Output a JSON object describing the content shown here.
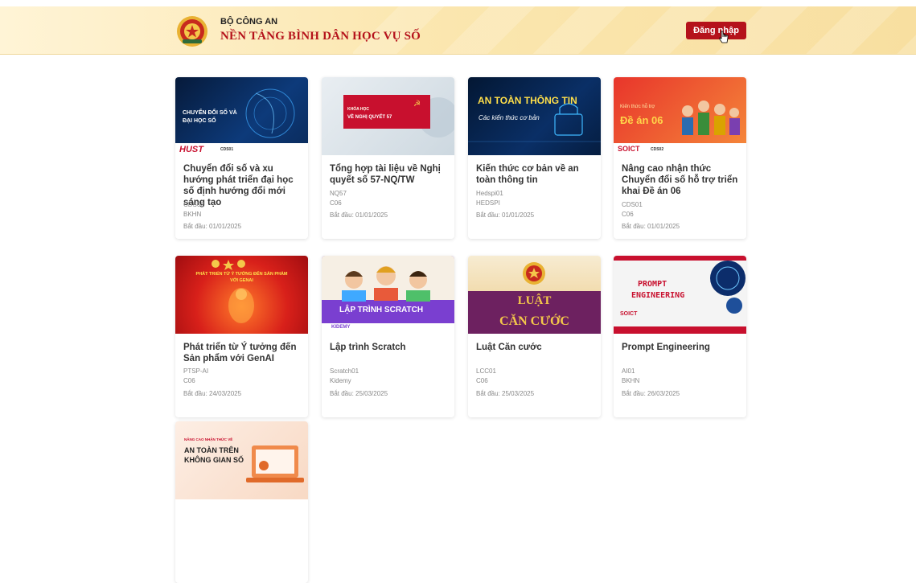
{
  "header": {
    "org_name": "BỘ CÔNG AN",
    "platform_name": "NỀN TẢNG BÌNH DÂN HỌC VỤ SỐ",
    "login_label": "Đăng nhập"
  },
  "courses": [
    {
      "title": "Chuyển đổi số và xu hướng phát triển đại học số định hướng đổi mới sáng tạo",
      "code": "CDS02",
      "org": "BKHN",
      "start": "Bắt đầu: 01/01/2025",
      "thumb": {
        "line1": "CHUYỂN ĐỔI SỐ VÀ",
        "line2": "ĐẠI HỌC SỐ",
        "brand": "HUST",
        "tag": "CDS01"
      }
    },
    {
      "title": "Tổng hợp tài liệu về Nghị quyết số 57-NQ/TW",
      "code": "NQ57",
      "org": "C06",
      "start": "Bắt đầu: 01/01/2025",
      "thumb": {
        "small": "KHÓA HỌC",
        "main": "VỀ NGHỊ QUYẾT 57"
      }
    },
    {
      "title": "Kiến thức cơ bản về an toàn thông tin",
      "code": "Hedspi01",
      "org": "HEDSPI",
      "start": "Bắt đầu: 01/01/2025",
      "thumb": {
        "main": "AN TOÀN THÔNG TIN",
        "sub": "Các kiến thức cơ bản"
      }
    },
    {
      "title": "Nâng cao nhận thức Chuyển đổi số hỗ trợ triển khai Đề án 06",
      "code": "CDS01",
      "org": "C06",
      "start": "Bắt đầu: 01/01/2025",
      "thumb": {
        "small": "Kiến thức hỗ trợ",
        "main": "Đề án 06",
        "brand": "SOICT",
        "tag": "CDS02"
      }
    },
    {
      "title": "Phát triển từ Ý tưởng đến Sản phẩm với GenAI",
      "code": "PTSP-AI",
      "org": "C06",
      "start": "Bắt đầu: 24/03/2025",
      "thumb": {
        "main": "PHÁT TRIỂN TỪ Ý TƯỞNG ĐẾN SẢN PHẨM",
        "sub": "VỚI GENAI"
      }
    },
    {
      "title": "Lập trình Scratch",
      "code": "Scratch01",
      "org": "Kidemy",
      "start": "Bắt đầu: 25/03/2025",
      "thumb": {
        "main": "LẬP TRÌNH SCRATCH",
        "brand": "KIDEMY"
      }
    },
    {
      "title": "Luật Căn cước",
      "code": "LCC01",
      "org": "C06",
      "start": "Bắt đầu: 25/03/2025",
      "thumb": {
        "line1": "LUẬT",
        "line2": "CĂN CƯỚC"
      }
    },
    {
      "title": "Prompt Engineering",
      "code": "AI01",
      "org": "BKHN",
      "start": "Bắt đầu: 26/03/2025",
      "thumb": {
        "line1": "PROMPT",
        "line2": "ENGINEERING",
        "brand": "SOICT"
      }
    },
    {
      "thumb": {
        "small": "NÂNG CAO NHẬN THỨC VỀ",
        "line1": "AN TOÀN TRÊN",
        "line2": "KHÔNG GIAN SỐ"
      }
    }
  ],
  "colors": {
    "brand_red": "#b5121b",
    "header_bg": "#fbe7b0"
  }
}
